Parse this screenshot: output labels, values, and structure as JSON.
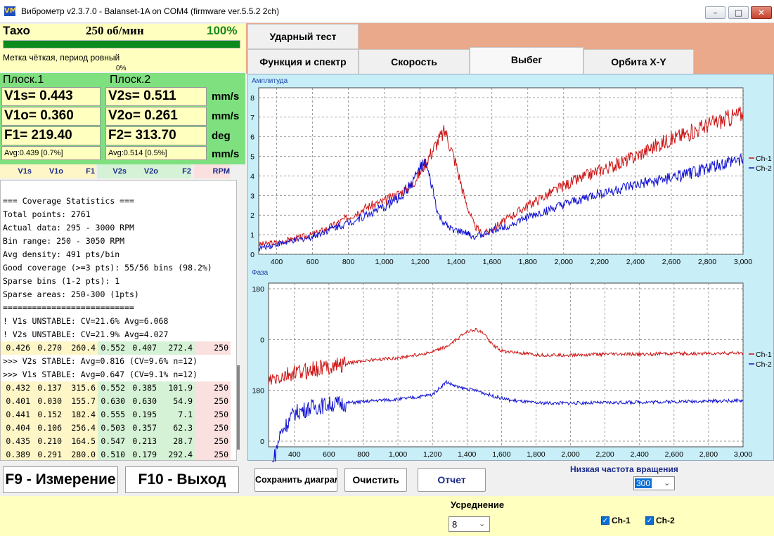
{
  "window": {
    "logo": "VM",
    "title": "Виброметр v2.3.7.0 - Balanset-1A on COM4 (firmware ver.5.5.2 2ch)",
    "minimize_icon": "minimize-icon",
    "maximize_icon": "maximize-icon",
    "close_icon": "close-icon"
  },
  "tacho": {
    "label": "Тахо",
    "rpm": "250 об/мин",
    "percent": "100%",
    "progress": 1.0,
    "mark_text": "Метка чёткая, период ровный",
    "zero_percent": "0%"
  },
  "plane1": {
    "label": "Плоск.1",
    "v1s": "V1s= 0.443",
    "v1o": "V1o= 0.360",
    "f1": "F1= 219.40",
    "avg": "Avg:0.439 [0.7%]"
  },
  "plane2": {
    "label": "Плоск.2",
    "v2s": "V2s= 0.511",
    "v2o": "V2o= 0.261",
    "f2": "F2= 313.70",
    "avg": "Avg:0.514 [0.5%]"
  },
  "units": [
    "mm/s",
    "mm/s",
    "deg",
    "mm/s"
  ],
  "columns": [
    "V1s",
    "V1o",
    "F1",
    "V2s",
    "V2o",
    "F2",
    "RPM"
  ],
  "stats_lines": [
    "=== Coverage Statistics ===",
    "Total points: 2761",
    "Actual data: 295 - 3000 RPM",
    "Bin range: 250 - 3050 RPM",
    "Avg density: 491 pts/bin",
    "Good coverage (>=3 pts): 55/56 bins (98.2%)",
    "Sparse bins (1-2 pts): 1",
    "Sparse areas: 250-300 (1pts)",
    "===========================",
    "! V1s UNSTABLE: CV=21.6% Avg=6.068",
    "! V2s UNSTABLE: CV=21.9% Avg=4.027"
  ],
  "row_first": [
    "0.426",
    "0.270",
    "260.4",
    "0.552",
    "0.407",
    "272.4",
    "250"
  ],
  "stable_lines": [
    ">>> V2s STABLE: Avg=0.816 (CV=9.6% n=12)",
    ">>> V1s STABLE: Avg=0.647 (CV=9.1% n=12)"
  ],
  "rows": [
    [
      "0.432",
      "0.137",
      "315.6",
      "0.552",
      "0.385",
      "101.9",
      "250"
    ],
    [
      "0.401",
      "0.030",
      "155.7",
      "0.630",
      "0.630",
      "54.9",
      "250"
    ],
    [
      "0.441",
      "0.152",
      "182.4",
      "0.555",
      "0.195",
      "7.1",
      "250"
    ],
    [
      "0.404",
      "0.106",
      "256.4",
      "0.503",
      "0.357",
      "62.3",
      "250"
    ],
    [
      "0.435",
      "0.210",
      "164.5",
      "0.547",
      "0.213",
      "28.7",
      "250"
    ],
    [
      "0.389",
      "0.291",
      "280.0",
      "0.510",
      "0.179",
      "292.4",
      "250"
    ]
  ],
  "buttons": {
    "measure": "F9 - Измерение",
    "exit": "F10 - Выход",
    "save_chart": "Сохранить диаграмму",
    "clear": "Очистить",
    "report": "Отчет"
  },
  "tabs": {
    "impact": "Ударный тест",
    "func_spectrum": "Функция и спектр",
    "speed": "Скорость",
    "rundown": "Выбег",
    "orbit": "Орбита X-Y"
  },
  "low_speed": {
    "label": "Низкая частота вращения",
    "value": "300"
  },
  "averaging": {
    "label": "Усреднение",
    "value": "8"
  },
  "channels": {
    "ch1": "Ch-1",
    "ch2": "Ch-2"
  },
  "colors": {
    "ch1": "#cc1414",
    "ch2": "#1010d0"
  },
  "chart_data": [
    {
      "type": "line",
      "title": "Амплитуда",
      "xlim": [
        300,
        3000
      ],
      "ylim": [
        0,
        8.5
      ],
      "x_ticks": [
        400,
        600,
        800,
        1000,
        1200,
        1400,
        1600,
        1800,
        2000,
        2200,
        2400,
        2600,
        2800,
        3000
      ],
      "x_tick_labels": [
        "400",
        "600",
        "800",
        "1,000",
        "1,200",
        "1,400",
        "1,600",
        "1,800",
        "2,000",
        "2,200",
        "2,400",
        "2,600",
        "2,800",
        "3,000"
      ],
      "y_ticks": [
        0,
        1,
        2,
        3,
        4,
        5,
        6,
        7,
        8
      ],
      "y_tick_labels": [
        "0",
        "1",
        "2",
        "3",
        "4",
        "5",
        "6",
        "7",
        "8"
      ],
      "grid": true,
      "legend": "right",
      "series": [
        {
          "name": "Ch-1",
          "x": [
            300,
            400,
            500,
            600,
            700,
            800,
            900,
            1000,
            1100,
            1150,
            1200,
            1250,
            1300,
            1340,
            1400,
            1450,
            1500,
            1550,
            1600,
            1700,
            1800,
            1900,
            2000,
            2100,
            2200,
            2300,
            2400,
            2500,
            2600,
            2700,
            2800,
            2900,
            3000
          ],
          "y": [
            0.5,
            0.6,
            0.8,
            1.0,
            1.4,
            1.9,
            2.4,
            2.7,
            3.2,
            3.5,
            4.2,
            5.0,
            5.8,
            6.3,
            4.6,
            2.8,
            1.5,
            1.0,
            1.3,
            1.9,
            2.5,
            3.0,
            3.5,
            3.9,
            4.3,
            4.6,
            5.0,
            5.5,
            5.9,
            6.2,
            6.6,
            6.9,
            7.2
          ]
        },
        {
          "name": "Ch-2",
          "x": [
            300,
            400,
            500,
            600,
            700,
            800,
            900,
            1000,
            1100,
            1150,
            1200,
            1230,
            1270,
            1300,
            1350,
            1400,
            1450,
            1500,
            1550,
            1600,
            1700,
            1800,
            1900,
            2000,
            2100,
            2200,
            2300,
            2400,
            2500,
            2600,
            2700,
            2800,
            2900,
            3000
          ],
          "y": [
            0.3,
            0.5,
            0.7,
            0.9,
            1.3,
            1.6,
            2.0,
            2.4,
            3.0,
            3.6,
            4.4,
            4.6,
            3.3,
            2.0,
            1.4,
            1.2,
            1.1,
            0.9,
            1.0,
            1.2,
            1.5,
            1.9,
            2.2,
            2.5,
            2.8,
            3.1,
            3.3,
            3.5,
            3.7,
            3.9,
            4.1,
            4.4,
            4.6,
            4.9
          ]
        }
      ]
    },
    {
      "type": "line",
      "title": "Фаза",
      "xlim": [
        250,
        3000
      ],
      "ylim": [
        -380,
        200
      ],
      "x_ticks": [
        400,
        600,
        800,
        1000,
        1200,
        1400,
        1600,
        1800,
        2000,
        2200,
        2400,
        2600,
        2800,
        3000
      ],
      "x_tick_labels": [
        "400",
        "600",
        "800",
        "1,000",
        "1,200",
        "1,400",
        "1,600",
        "1,800",
        "2,000",
        "2,200",
        "2,400",
        "2,600",
        "2,800",
        "3,000"
      ],
      "y_ticks": [
        180,
        0,
        -180,
        -360
      ],
      "y_tick_labels": [
        "180",
        "0",
        "180",
        "0",
        "180"
      ],
      "grid": true,
      "legend": "right",
      "series": [
        {
          "name": "Ch-1",
          "x": [
            250,
            400,
            600,
            800,
            1000,
            1100,
            1200,
            1300,
            1400,
            1450,
            1500,
            1550,
            1600,
            1800,
            2000,
            2200,
            2400,
            2600,
            2800,
            3000
          ],
          "y": [
            -150,
            -120,
            -95,
            -75,
            -65,
            -55,
            -45,
            -20,
            30,
            35,
            20,
            -20,
            -40,
            -55,
            -55,
            -52,
            -52,
            -50,
            -50,
            -48
          ]
        },
        {
          "name": "Ch-2",
          "x": [
            270,
            320,
            400,
            500,
            600,
            700,
            800,
            900,
            1000,
            1100,
            1200,
            1280,
            1350,
            1450,
            1550,
            1650,
            1800,
            2000,
            2200,
            2400,
            2600,
            2800,
            3000
          ],
          "y": [
            -450,
            -330,
            -260,
            -240,
            -230,
            -225,
            -220,
            -215,
            -212,
            -205,
            -195,
            -150,
            -170,
            -180,
            -200,
            -215,
            -225,
            -225,
            -224,
            -222,
            -220,
            -218,
            -217
          ]
        }
      ]
    }
  ]
}
